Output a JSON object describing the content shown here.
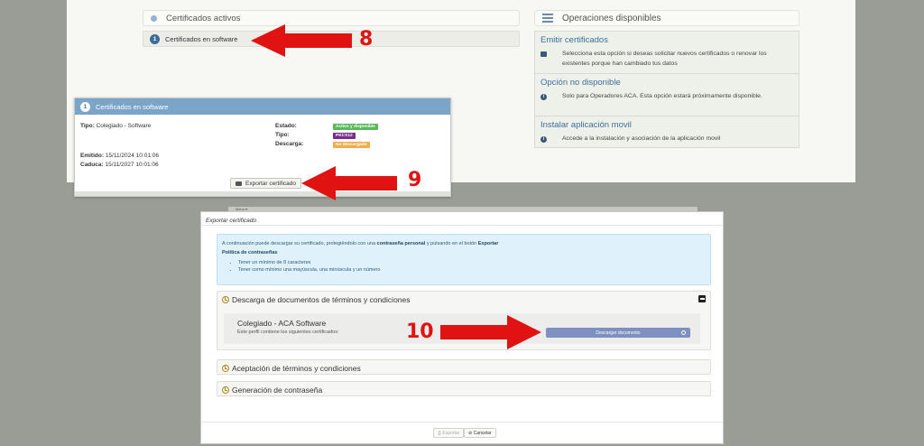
{
  "top": {
    "active_title": "Certificados activos",
    "software_item": "Certificados en software",
    "software_item_num": "1",
    "ops_title": "Operaciones disponibles",
    "ops": [
      {
        "title": "Emitir certificados",
        "icon": "certificate-icon",
        "desc": "Selecciona esta opción si deseas solicitar nuevos certificados o renovar los existentes porque han cambiado tus datos"
      },
      {
        "title": "Opción no disponible",
        "icon": "info-icon",
        "desc": "Solo para Operadores ACA. Esta opción estará próximamente disponible."
      },
      {
        "title": "Instalar aplicación movil",
        "icon": "info-icon",
        "desc": "Accede a la instalación y asociación de la aplicación movil"
      }
    ]
  },
  "popup": {
    "num": "1",
    "title": "Certificados en software",
    "tipo_label": "Tipo:",
    "tipo_value": "Colegiado - Software",
    "estado_label": "Estado:",
    "estado_value": "Activo y disponible",
    "tipo2_label": "Tipo:",
    "tipo2_value": "PKCS12",
    "descarga_label": "Descarga:",
    "descarga_value": "No descargado",
    "emitido_label": "Emitido:",
    "emitido_value": "15/11/2024 10:01:06",
    "caduca_label": "Caduca:",
    "caduca_value": "15/11/2027 10:01:06",
    "export_button": "Exportar certificado",
    "colors": {
      "estado": "#5cb85c",
      "tipo2": "#7a2b8c",
      "descarga": "#f0ad4e"
    }
  },
  "modal": {
    "menu_strip": "Menu ▾",
    "title": "Exportar certificado",
    "info_line_prefix": "A continuación puede descargar su certificado, protegiéndolo con una ",
    "info_line_bold1": "contraseña personal",
    "info_line_mid": " y pulsando en el botón ",
    "info_line_bold2": "Exportar",
    "policy_title": "Política de contraseñas",
    "policy_items": [
      "Tener un mínimo de 8 caracteres",
      "Tener como mínimo una mayúscula, una minúscula y un número"
    ],
    "section1": "Descarga de documentos de términos y condiciones",
    "profile_name": "Colegiado - ACA Software",
    "profile_sub": "Este perfil contiene los siguientes certificados:",
    "download_button": "Descargar documento",
    "section2": "Aceptación de términos y condiciones",
    "section3": "Generación de contraseña",
    "export_button": "⎙ Exportar",
    "cancel_button": "⊘ Cancelar"
  },
  "callouts": {
    "c8": "8",
    "c9": "9",
    "c10": "10",
    "arrow_color": "#e01212"
  }
}
